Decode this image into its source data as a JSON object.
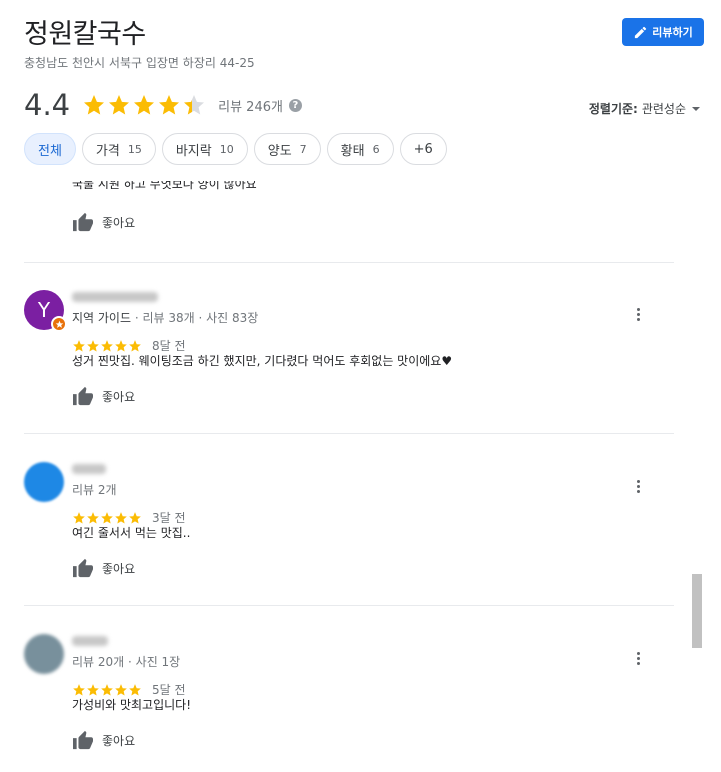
{
  "place": {
    "title": "정원칼국수",
    "address": "충청남도 천안시 서북구 입장면 하장리 44-25",
    "write_review_label": "리뷰하기",
    "rating": "4.4",
    "rating_stars": 4.4,
    "review_count_label": "리뷰 246개"
  },
  "sort": {
    "label": "정렬기준:",
    "value": "관련성순"
  },
  "chips": [
    {
      "label": "전체",
      "count": ""
    },
    {
      "label": "가격",
      "count": "15"
    },
    {
      "label": "바지락",
      "count": "10"
    },
    {
      "label": "양도",
      "count": "7"
    },
    {
      "label": "황태",
      "count": "6"
    },
    {
      "label": "+6",
      "count": ""
    }
  ],
  "partial_review": {
    "text": "국물 시원 하고 무엇보다 양이 많아요",
    "like_label": "좋아요"
  },
  "reviews": [
    {
      "avatar_letter": "Y",
      "avatar_color": "#7b1fa2",
      "meta_lead": "지역 가이드",
      "meta_rest": " · 리뷰 38개 · 사진 83장",
      "stars": 5,
      "time": "8달 전",
      "text": "성거 찐맛집. 웨이팅조금 하긴 했지만, 기다렸다 먹어도 후회없는 맛이에요♥",
      "like_label": "좋아요"
    },
    {
      "avatar_letter": "",
      "avatar_color": "#1e88e5",
      "meta_lead": "",
      "meta_rest": "리뷰 2개",
      "stars": 5,
      "time": "3달 전",
      "text": "여긴 줄서서 먹는 맛집..",
      "like_label": "좋아요"
    },
    {
      "avatar_letter": "",
      "avatar_color": "#78909c",
      "meta_lead": "",
      "meta_rest": "리뷰 20개 · 사진 1장",
      "stars": 5,
      "time": "5달 전",
      "text": "가성비와 맛최고입니다!",
      "like_label": "좋아요"
    }
  ],
  "colors": {
    "star": "#fbbc04",
    "accent": "#1a73e8",
    "chip_active_bg": "#e8f0fe"
  }
}
